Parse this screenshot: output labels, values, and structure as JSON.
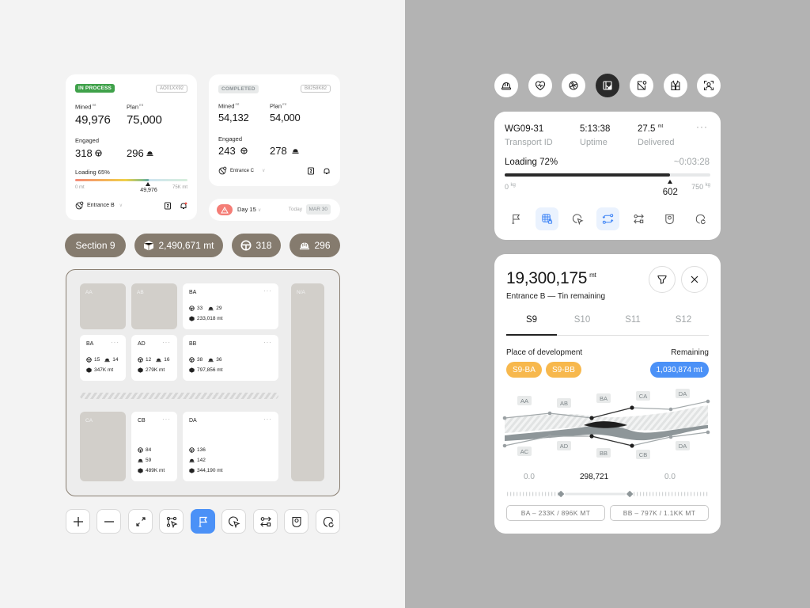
{
  "cards": {
    "in_process": {
      "status": "IN PROCESS",
      "id": "AO01XX92",
      "mined_label": "Mined",
      "plan_label": "Plan",
      "unit": "mt",
      "mined": "49,976",
      "plan": "75,000",
      "engaged_label": "Engaged",
      "drivers": "318",
      "workers": "296",
      "loading_label": "Loading 65%",
      "loading_fraction": 0.65,
      "min": "0 mt",
      "max": "75K mt",
      "current": "49,976",
      "entrance": "Entrance B",
      "status_color": "#3fa14a"
    },
    "completed": {
      "status": "COMPLETED",
      "id": "B8258K82",
      "mined_label": "Mined",
      "plan_label": "Plan",
      "unit": "mt",
      "mined": "54,132",
      "plan": "54,000",
      "engaged_label": "Engaged",
      "drivers": "243",
      "workers": "278",
      "entrance": "Entrance C"
    },
    "day": {
      "day": "Day 15",
      "today": "Today",
      "date": "MAR 30"
    }
  },
  "pills": {
    "section": "Section 9",
    "mass": "2,490,671 mt",
    "drivers": "318",
    "workers": "296"
  },
  "map": {
    "empty_cells": [
      "AA",
      "AB",
      "CA",
      "N/A"
    ],
    "cells": [
      {
        "label": "BA",
        "drivers": "33",
        "workers": "29",
        "mass": "233,018 mt"
      },
      {
        "label": "BA",
        "drivers": "15",
        "workers": "14",
        "mass": "347K mt"
      },
      {
        "label": "AD",
        "drivers": "12",
        "workers": "16",
        "mass": "279K mt"
      },
      {
        "label": "BB",
        "drivers": "38",
        "workers": "36",
        "mass": "797,856 mt"
      },
      {
        "label": "CB",
        "drivers": "84",
        "workers": "59",
        "mass": "489K mt"
      },
      {
        "label": "DA",
        "drivers": "136",
        "workers": "142",
        "mass": "344,190 mt"
      }
    ],
    "more": "···"
  },
  "toolbar": {
    "items": [
      "zoom-in",
      "zoom-out",
      "expand",
      "route",
      "flag",
      "select",
      "swap",
      "tag",
      "refresh"
    ],
    "active": "flag"
  },
  "top_icons": {
    "items": [
      "helmet",
      "health",
      "aperture",
      "layout",
      "map-pin",
      "vest",
      "face-scan"
    ],
    "active": "layout"
  },
  "transport": {
    "id": "WG09-31",
    "id_label": "Transport ID",
    "uptime": "5:13:38",
    "uptime_label": "Uptime",
    "delivered": "27.5",
    "delivered_unit": "mt",
    "delivered_label": "Delivered",
    "more": "···",
    "loading_label": "Loading 72%",
    "loading_fraction": 0.8027,
    "eta": "~0:03:28",
    "min": "0",
    "max": "750",
    "unit": "kg",
    "current": "602",
    "tools": [
      "flag",
      "grid-lock",
      "select",
      "route-swap",
      "swap",
      "tag",
      "refresh"
    ],
    "selected_tools": [
      "grid-lock",
      "route-swap"
    ]
  },
  "remaining": {
    "total": "19,300,175",
    "unit": "mt",
    "subtitle": "Entrance B — Tin remaining",
    "tabs": [
      "S9",
      "S10",
      "S11",
      "S12"
    ],
    "active_tab": "S9",
    "place_label": "Place of development",
    "remaining_label": "Remaining",
    "chips": [
      "S9-BA",
      "S9-BB"
    ],
    "remaining_value": "1,030,874 mt",
    "flow_top_labels": [
      "AA",
      "AB",
      "BA",
      "CA",
      "DA"
    ],
    "flow_bottom_labels": [
      "AC",
      "AD",
      "BB",
      "CB",
      "DA"
    ],
    "values": [
      "0.0",
      "298,721",
      "0.0"
    ],
    "slider_range": [
      0.27,
      0.61
    ],
    "ranges": [
      "BA – 233K / 896K MT",
      "BB – 797K / 1.1KK MT"
    ],
    "chip_color": "#f7b84d",
    "value_color": "#4b91f7"
  }
}
